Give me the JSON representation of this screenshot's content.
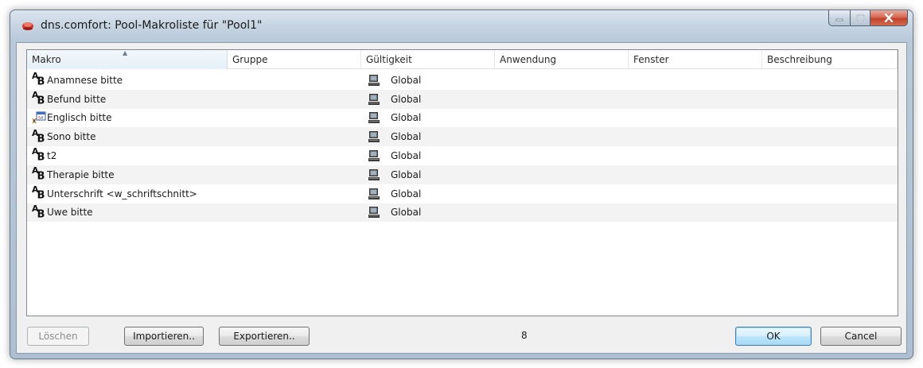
{
  "window": {
    "title": "dns.comfort: Pool-Makroliste für \"Pool1\"",
    "accent_color": "#b9c9da",
    "close_color": "#c2422c"
  },
  "columns": [
    "Makro",
    "Gruppe",
    "Gültigkeit",
    "Anwendung",
    "Fenster",
    "Beschreibung"
  ],
  "rows": [
    {
      "icon": "text-macro-icon",
      "makro": "Anamnese bitte",
      "gruppe": "",
      "gueltigkeit": "Global",
      "anwendung": "",
      "fenster": "",
      "beschreibung": ""
    },
    {
      "icon": "text-macro-icon",
      "makro": "Befund bitte",
      "gruppe": "",
      "gueltigkeit": "Global",
      "anwendung": "",
      "fenster": "",
      "beschreibung": ""
    },
    {
      "icon": "script-macro-icon",
      "makro": "Englisch bitte",
      "gruppe": "",
      "gueltigkeit": "Global",
      "anwendung": "",
      "fenster": "",
      "beschreibung": ""
    },
    {
      "icon": "text-macro-icon",
      "makro": "Sono bitte",
      "gruppe": "",
      "gueltigkeit": "Global",
      "anwendung": "",
      "fenster": "",
      "beschreibung": ""
    },
    {
      "icon": "text-macro-icon",
      "makro": "t2",
      "gruppe": "",
      "gueltigkeit": "Global",
      "anwendung": "",
      "fenster": "",
      "beschreibung": ""
    },
    {
      "icon": "text-macro-icon",
      "makro": "Therapie bitte",
      "gruppe": "",
      "gueltigkeit": "Global",
      "anwendung": "",
      "fenster": "",
      "beschreibung": ""
    },
    {
      "icon": "text-macro-icon",
      "makro": "Unterschrift <w_schriftschnitt>",
      "gruppe": "",
      "gueltigkeit": "Global",
      "anwendung": "",
      "fenster": "",
      "beschreibung": ""
    },
    {
      "icon": "text-macro-icon",
      "makro": "Uwe bitte",
      "gruppe": "",
      "gueltigkeit": "Global",
      "anwendung": "",
      "fenster": "",
      "beschreibung": ""
    }
  ],
  "footer": {
    "delete_label": "Löschen",
    "import_label": "Importieren..",
    "export_label": "Exportieren..",
    "count": "8",
    "ok_label": "OK",
    "cancel_label": "Cancel"
  }
}
